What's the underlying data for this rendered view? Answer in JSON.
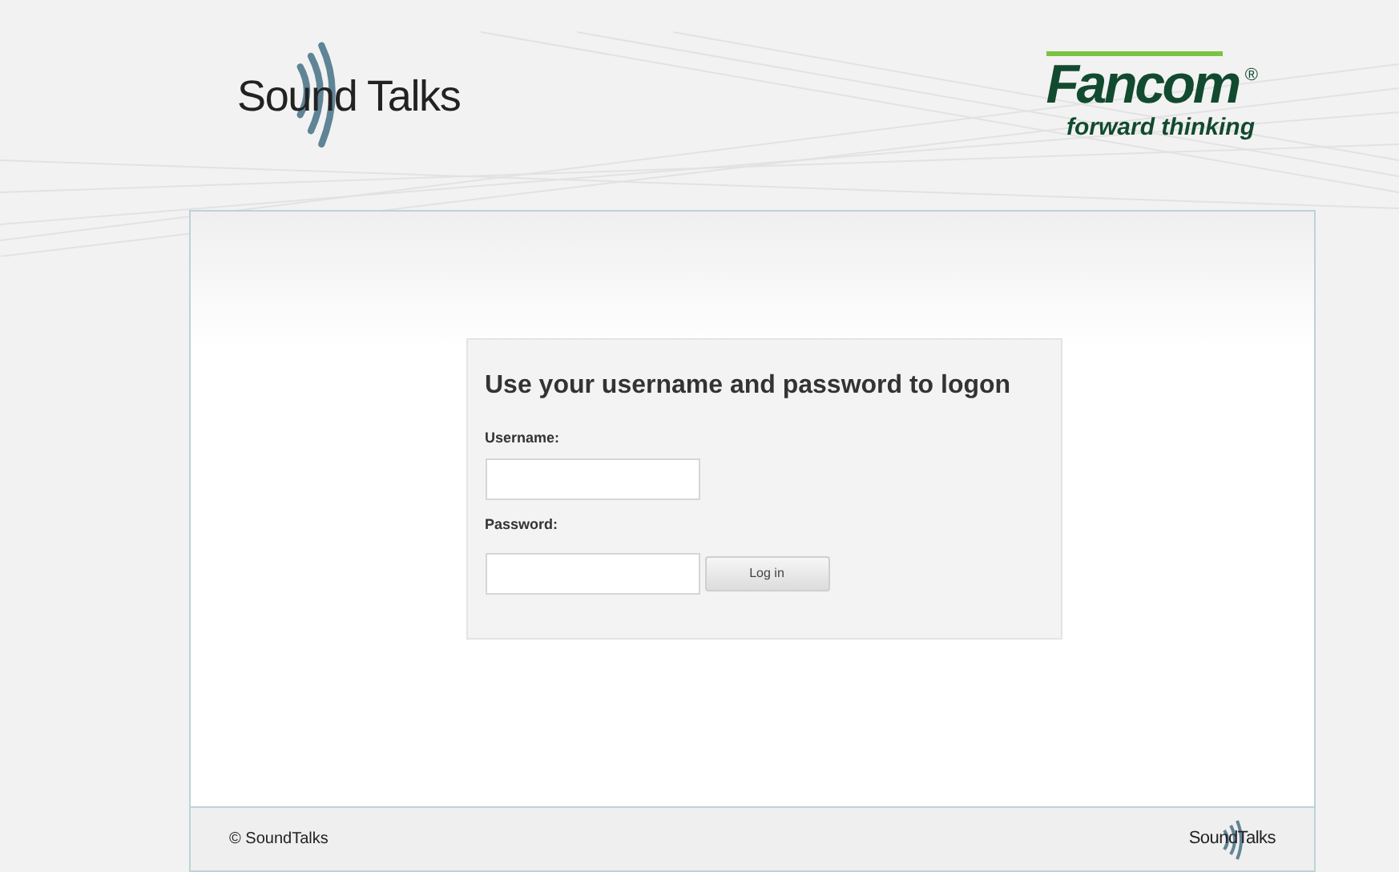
{
  "header": {
    "logo_left": "Sound Talks",
    "logo_right": {
      "name": "Fancom",
      "mark": "®",
      "tagline": "forward thinking"
    }
  },
  "login": {
    "title": "Use your username and password to logon",
    "fields": [
      {
        "label": "Username:"
      },
      {
        "label": "Password:"
      }
    ],
    "button": "Log in"
  },
  "footer": {
    "copyright": "© SoundTalks",
    "logo": "SoundTalks"
  }
}
